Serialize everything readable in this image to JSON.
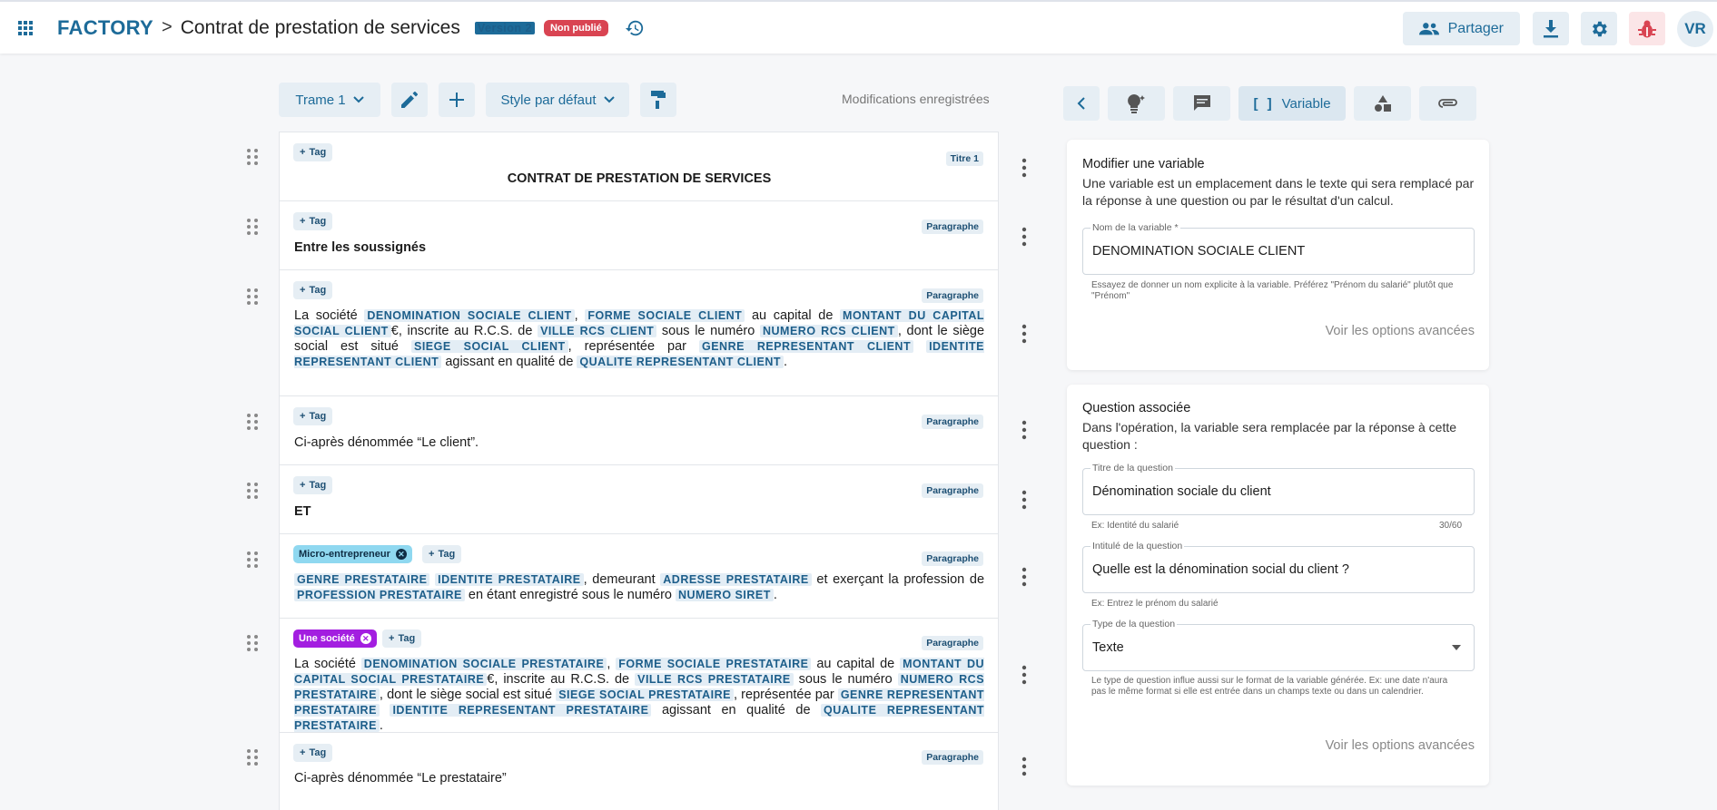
{
  "header": {
    "brand": "FACTORY",
    "separator": ">",
    "doc_title": "Contrat de prestation de services",
    "version_badge": "Version 2",
    "status_badge": "Non publié",
    "share_label": "Partager",
    "avatar_initials": "VR"
  },
  "toolbar": {
    "trame": "Trame 1",
    "style": "Style par défaut",
    "saved_status": "Modifications enregistrées"
  },
  "editor": {
    "tag_label": "Tag",
    "blocks": [
      {
        "type_label": "Titre 1",
        "text": "CONTRAT DE PRESTATION DE SERVICES"
      },
      {
        "type_label": "Paragraphe",
        "text": "Entre les soussignés"
      },
      {
        "type_label": "Paragraphe",
        "t1": "La société",
        "v1": "DENOMINATION SOCIALE CLIENT",
        "t2": ",",
        "v2": "FORME SOCIALE CLIENT",
        "t3": "au capital de",
        "v3": "MONTANT DU CAPITAL SOCIAL CLIENT",
        "t4": "€, inscrite au R.C.S. de",
        "v4": "VILLE RCS CLIENT",
        "t5": "sous le numéro",
        "v5": "NUMERO RCS CLIENT",
        "t6": ", dont le siège social est situé",
        "v6": "SIEGE SOCIAL CLIENT",
        "t7": ", représentée par",
        "v7": "GENRE REPRESENTANT CLIENT",
        "v8": "IDENTITE REPRESENTANT CLIENT",
        "t8": "agissant en qualité de",
        "v9": "QUALITE REPRESENTANT CLIENT",
        "t9": "."
      },
      {
        "type_label": "Paragraphe",
        "text": "Ci-après dénommée “Le client”."
      },
      {
        "type_label": "Paragraphe",
        "text": "ET"
      },
      {
        "type_label": "Paragraphe",
        "condition": "Micro-entrepreneur",
        "v1": "GENRE PRESTATAIRE",
        "v2": "IDENTITE PRESTATAIRE",
        "t1": ", demeurant",
        "v3": "ADRESSE PRESTATAIRE",
        "t2": "et exerçant la profession de",
        "v4": "PROFESSION PRESTATAIRE",
        "t3": "en étant enregistré sous le numéro",
        "v5": "NUMERO SIRET",
        "t4": "."
      },
      {
        "type_label": "Paragraphe",
        "condition": "Une société",
        "t1": "La société",
        "v1": "DENOMINATION SOCIALE PRESTATAIRE",
        "t2": ",",
        "v2": "FORME SOCIALE PRESTATAIRE",
        "t3": "au capital de",
        "v3": "MONTANT DU CAPITAL SOCIAL PRESTATAIRE",
        "t4": "€, inscrite au R.C.S. de",
        "v4": "VILLE RCS PRESTATAIRE",
        "t5": "sous le numéro",
        "v5": "NUMERO RCS PRESTATAIRE",
        "t6": ", dont le siège social est situé",
        "v6": "SIEGE SOCIAL PRESTATAIRE",
        "t7": ", représentée par",
        "v7": "GENRE REPRESENTANT PRESTATAIRE",
        "v8": "IDENTITE REPRESENTANT PRESTATAIRE",
        "t8": "agissant en qualité de",
        "v9": "QUALITE REPRESENTANT PRESTATAIRE",
        "t9": "."
      },
      {
        "type_label": "Paragraphe",
        "text": "Ci-après dénommée “Le prestataire”"
      }
    ]
  },
  "panel": {
    "active_tab": "Variable",
    "variable": {
      "title": "Modifier une variable",
      "description": "Une variable est un emplacement dans le texte qui sera remplacé par la réponse à une question ou par le résultat d'un calcul.",
      "name_label": "Nom de la variable *",
      "name_value": "DENOMINATION SOCIALE CLIENT",
      "name_hint": "Essayez de donner un nom explicite à la variable. Préférez \"Prénom du salarié\" plutôt que \"Prénom\"",
      "advanced": "Voir les options avancées"
    },
    "question": {
      "title": "Question associée",
      "description": "Dans l'opération, la variable sera remplacée par la réponse à cette question :",
      "title_label": "Titre de la question",
      "title_value": "Dénomination sociale du client",
      "title_hint": "Ex: Identité du salarié",
      "title_count": "30/60",
      "intitule_label": "Intitulé de la question",
      "intitule_value": "Quelle est la dénomination social du client ?",
      "intitule_hint": "Ex: Entrez le prénom du salarié",
      "type_label": "Type de la question",
      "type_value": "Texte",
      "type_hint": "Le type de question influe aussi sur le format de la variable générée. Ex: une date n'aura pas le même format si elle est entrée dans un champs texte ou dans un calendrier.",
      "advanced": "Voir les options avancées"
    }
  },
  "colors": {
    "accent": "#1d6b99",
    "tint": "#e6eef4",
    "danger": "#d94452",
    "cond_cyan": "#8fd8f0",
    "cond_purple": "#a31ee0"
  }
}
